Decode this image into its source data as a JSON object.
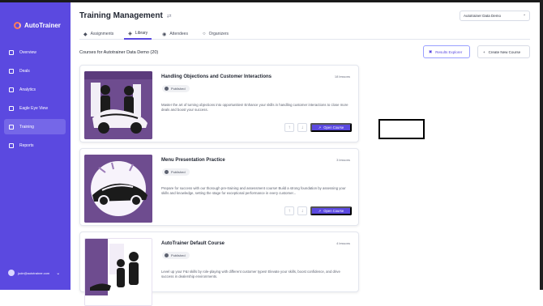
{
  "app": {
    "name": "AutoTrainer"
  },
  "sidebar": {
    "items": [
      {
        "label": "Overview",
        "icon": "grid-icon"
      },
      {
        "label": "Deals",
        "icon": "deals-icon"
      },
      {
        "label": "Analytics",
        "icon": "analytics-icon"
      },
      {
        "label": "Eagle Eye View",
        "icon": "document-icon"
      },
      {
        "label": "Training",
        "icon": "graduation-cap-icon",
        "active": true
      },
      {
        "label": "Reports",
        "icon": "reports-icon"
      }
    ],
    "user_email": "jude@autotrainer.com"
  },
  "page": {
    "title": "Training Management",
    "org_selector": "Autotrainer Data Demo",
    "tabs": [
      {
        "label": "Assignments"
      },
      {
        "label": "Library",
        "active": true
      },
      {
        "label": "Attendees"
      },
      {
        "label": "Organizers"
      }
    ],
    "section_title": "Courses for Autotrainer Data Demo (20)",
    "results_explorer_label": "Results Explorer",
    "create_course_label": "Create New Course"
  },
  "courses": [
    {
      "title": "Handling Objections and Customer Interactions",
      "lessons": "18 lessons",
      "status": "Published",
      "description": "Master the art of turning objections into opportunities! Enhance your skills in handling customer interactions to close more deals and boost your success.",
      "open_label": "Open Course"
    },
    {
      "title": "Menu Presentation Practice",
      "lessons": "3 lessons",
      "status": "Published",
      "description": "Prepare for success with our thorough pre-training and assessment course! Build a strong foundation by assessing your skills and knowledge, setting the stage for exceptional performance in every customer...",
      "open_label": "Open Course"
    },
    {
      "title": "AutoTrainer Default Course",
      "lessons": "4 lessons",
      "status": "Published",
      "description": "Level up your F&I skills by role-playing with different customer types! Elevate your skills, boost confidence, and drive success in dealership environments.",
      "open_label": "Open Course"
    }
  ],
  "colors": {
    "sidebar": "#5b49e0",
    "accent": "#5b49e0",
    "logo_accent": "#ff7a59"
  }
}
